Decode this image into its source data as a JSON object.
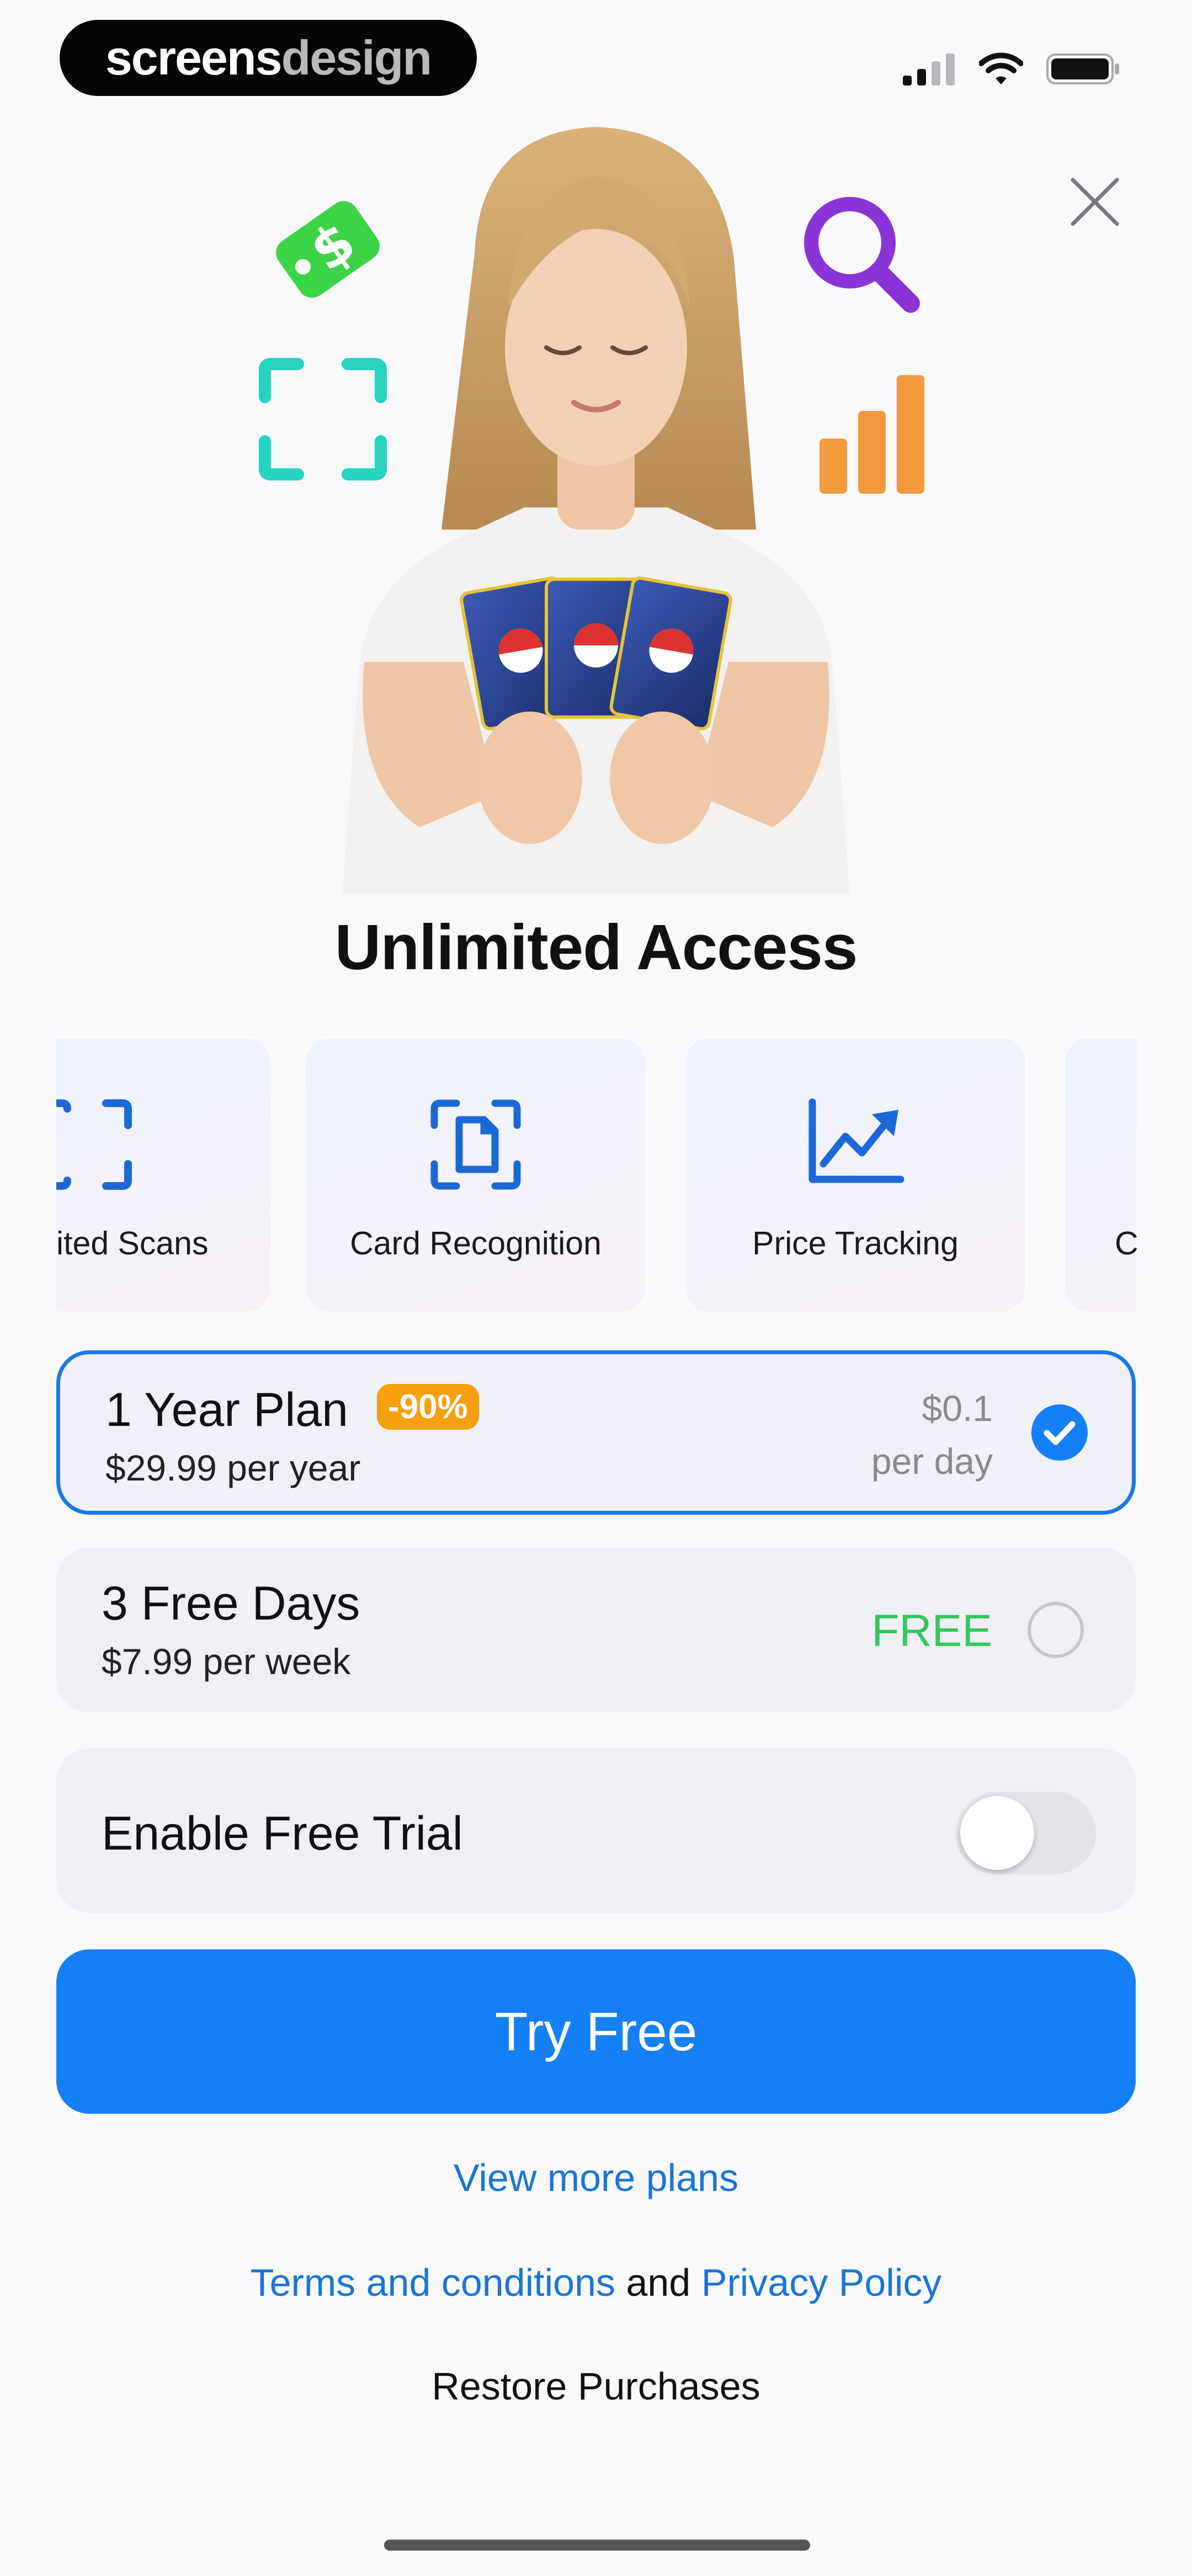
{
  "brand": {
    "part1": "screens",
    "part2": "design"
  },
  "title": "Unlimited Access",
  "features": [
    {
      "label": "ited Scans",
      "icon": "scan-frame-icon"
    },
    {
      "label": "Card Recognition",
      "icon": "card-document-icon"
    },
    {
      "label": "Price Tracking",
      "icon": "chart-trend-icon"
    },
    {
      "label": "C",
      "icon": ""
    }
  ],
  "plans": [
    {
      "name": "1 Year Plan",
      "badge": "-90%",
      "sub": "$29.99 per year",
      "price": "$0.1",
      "period": "per day",
      "selected": true
    },
    {
      "name": "3 Free Days",
      "sub": "$7.99 per week",
      "price": "FREE",
      "selected": false
    }
  ],
  "trial": {
    "label": "Enable Free Trial",
    "enabled": false
  },
  "cta": "Try Free",
  "links": {
    "more": "View more plans",
    "terms": "Terms and conditions",
    "and": "and",
    "privacy": "Privacy Policy",
    "restore": "Restore Purchases"
  },
  "colors": {
    "accent": "#1580f5",
    "badge": "#f5a00f",
    "free": "#34c759"
  }
}
